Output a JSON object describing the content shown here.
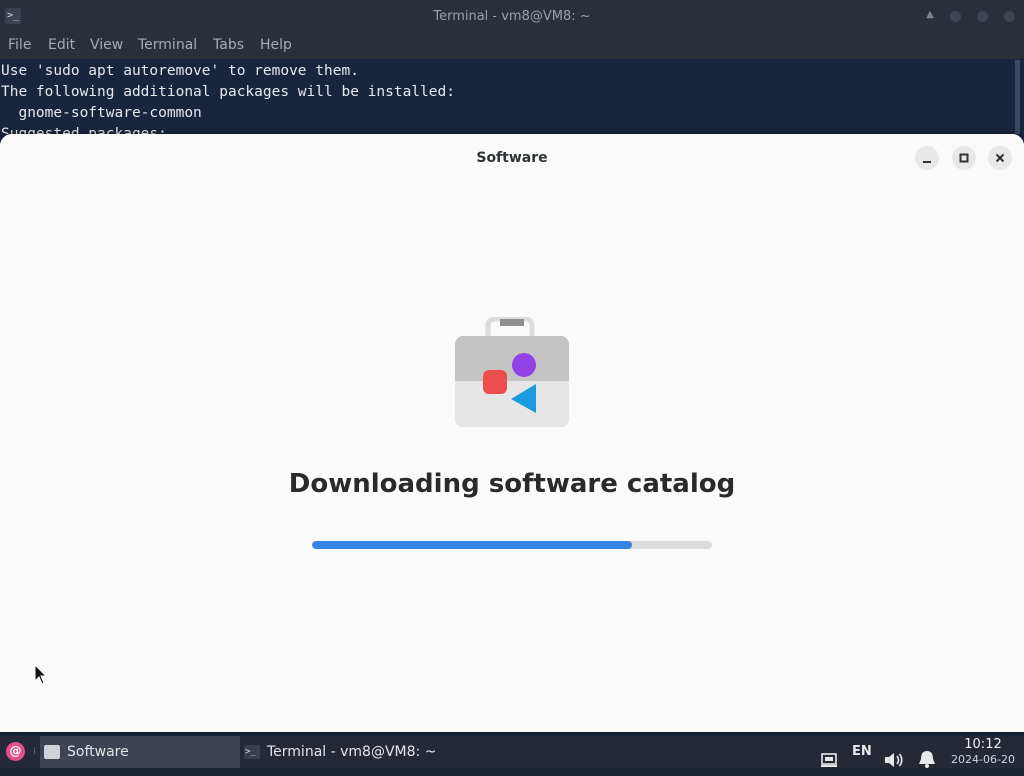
{
  "terminal": {
    "title": "Terminal - vm8@VM8: ~",
    "menu": [
      "File",
      "Edit",
      "View",
      "Terminal",
      "Tabs",
      "Help"
    ],
    "lines": [
      "Use 'sudo apt autoremove' to remove them.",
      "The following additional packages will be installed:",
      "  gnome-software-common",
      "Suggested packages:"
    ]
  },
  "software": {
    "title": "Software",
    "heading": "Downloading software catalog",
    "progress": 0.8,
    "colors": {
      "accent": "#3584e4",
      "track": "#dcdcdc"
    }
  },
  "taskbar": {
    "items": [
      {
        "label": "Software",
        "active": true
      },
      {
        "label": "Terminal - vm8@VM8: ~",
        "active": false
      }
    ],
    "keyboard_layout": "EN",
    "time": "10:12",
    "date": "2024-06-20"
  }
}
